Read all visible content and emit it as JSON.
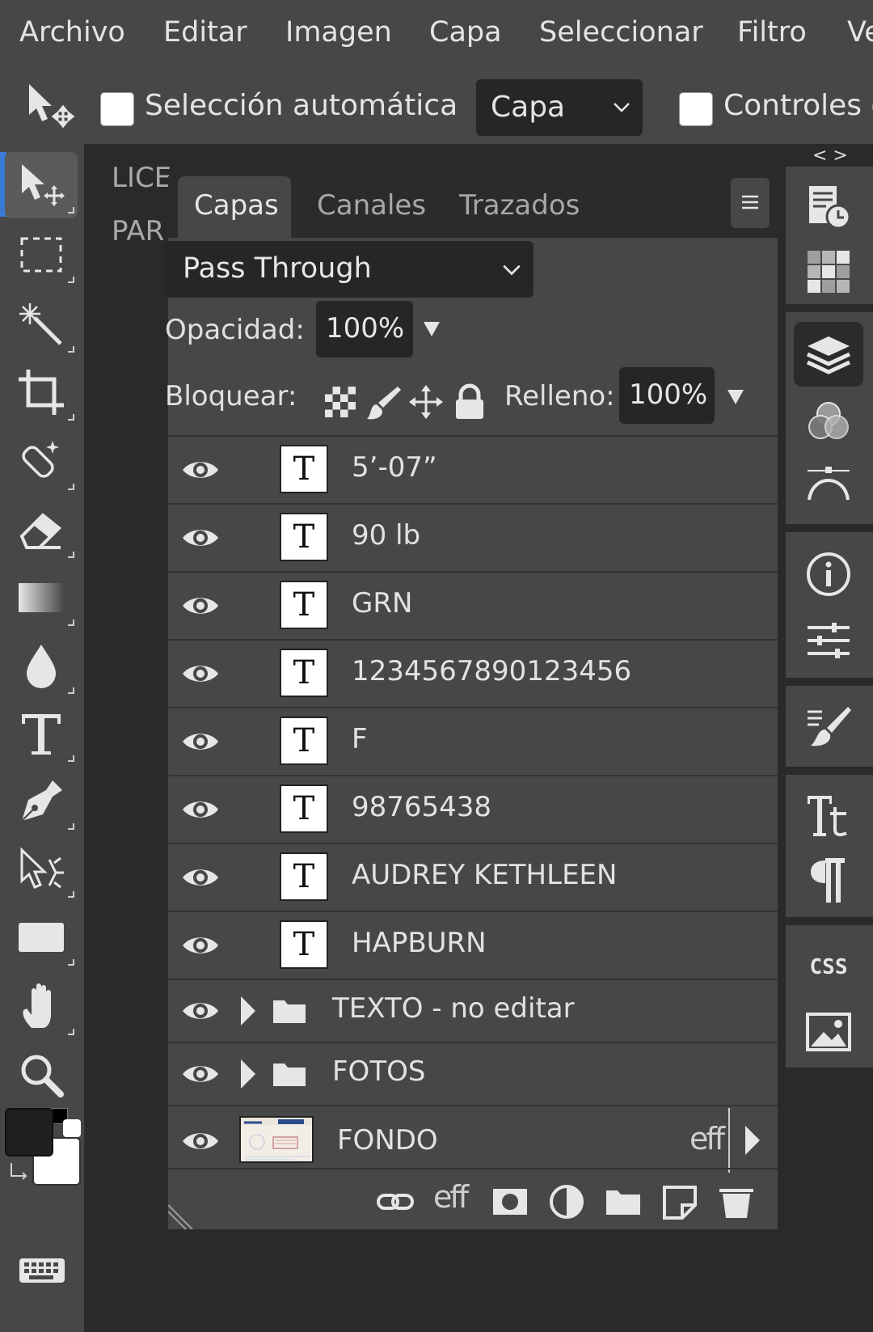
{
  "menu": [
    "Archivo",
    "Editar",
    "Imagen",
    "Capa",
    "Seleccionar",
    "Filtro",
    "Ve"
  ],
  "options": {
    "auto_select_label": "Selección automática",
    "target_value": "Capa",
    "controls_label": "Controles d"
  },
  "canvas": {
    "ghost_line1": "LICE",
    "ghost_line2": "PAR"
  },
  "dock": {
    "collapse_arrows": "< >"
  },
  "panel": {
    "tabs": [
      "Capas",
      "Canales",
      "Trazados"
    ],
    "blend_mode": "Pass Through",
    "opacity_label": "Opacidad:",
    "opacity_value": "100%",
    "lock_label": "Bloquear:",
    "fill_label": "Relleno:",
    "fill_value": "100%",
    "layers": [
      {
        "name": "5’-07”",
        "type": "text"
      },
      {
        "name": "90 lb",
        "type": "text"
      },
      {
        "name": "GRN",
        "type": "text"
      },
      {
        "name": "1234567890123456",
        "type": "text"
      },
      {
        "name": "F",
        "type": "text"
      },
      {
        "name": "98765438",
        "type": "text"
      },
      {
        "name": "AUDREY KETHLEEN",
        "type": "text"
      },
      {
        "name": "HAPBURN",
        "type": "text"
      },
      {
        "name": "TEXTO - no editar",
        "type": "group"
      },
      {
        "name": "FOTOS",
        "type": "group"
      },
      {
        "name": "FONDO",
        "type": "image",
        "effects_label": "eff"
      }
    ],
    "text_thumb_glyph": "T",
    "bottom_eff_label": "eff"
  },
  "colors": {
    "foreground": "#1f1f1f",
    "background": "#ffffff",
    "accent": "#3a7bd5"
  }
}
